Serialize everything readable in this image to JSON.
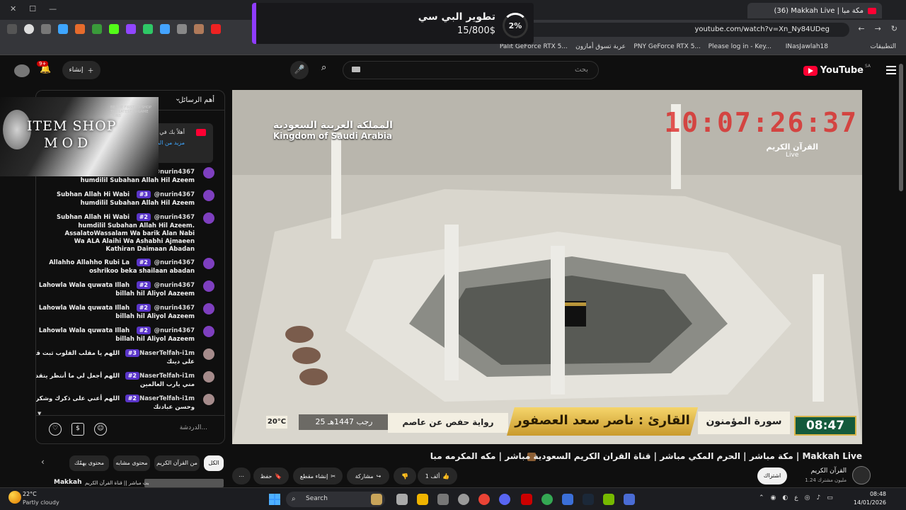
{
  "browser": {
    "tab_title": "(36) Makkah Live | مكة مبا",
    "url": "youtube.com/watch?v=Xn_Ny84UDeg",
    "bookmarks": [
      "التطبيقات",
      "INasJawlah18",
      "Please log in - Key...",
      "PNY GeForce RTX 5...",
      "عربة تسوق أمازون",
      "Palit GeForce RTX 5..."
    ]
  },
  "promo": {
    "title": "تطوير البي سي",
    "amount": "15/800$",
    "percent": "2%",
    "progress_fraction": 0.02
  },
  "header": {
    "logo_text": "YouTube",
    "region": "SA",
    "search_placeholder": "بحث",
    "create_label": "إنشاء",
    "notification_count": "9+"
  },
  "player": {
    "clock": "10:07:26:37",
    "channel_logo_title": "القرآن الكريم",
    "channel_logo_sub": "Live",
    "country_ar": "المملكة العربية السعودية",
    "country_en": "Kingdom of Saudi Arabia",
    "time": "08:47",
    "surah": "سورة المؤمنون",
    "reciter": "القارئ : ناصر سعد العصفور",
    "riwaya": "رواية حفص عن عاصم",
    "hijri_date": "25 رجب 1447هـ",
    "temperature": "20°C"
  },
  "overlay": {
    "line1": "ITEM SHOP",
    "line2": "MOD",
    "tiny_text": "BE THE FIRST TO SHOP THE LATEST IN-GAME SKINS"
  },
  "chat": {
    "header": "أهم الرسائل",
    "pinned_text": "أهلاً بك في الدردشة المباشرة! يُرجى احترام الآخرين",
    "pinned_more": "مزيد من المعلومات",
    "input_placeholder": "الدردشة...",
    "messages": [
      {
        "user": "@nurin4367",
        "badge": "",
        "first": "",
        "text": "humdilil Subahan Allah Hil Azeem"
      },
      {
        "user": "@nurin4367",
        "badge": "#3",
        "first": "Subhan Allah Hi Wabi",
        "text": "humdilil Subahan Allah Hil Azeem"
      },
      {
        "user": "@nurin4367",
        "badge": "#2",
        "first": "Subhan Allah Hi Wabi",
        "text": "humdilil Subahan Allah Hil Azeem. AssalatoWassalam Wa barik Alan Nabi Wa ALA Alaihi Wa Ashabhi Ajmaeen Kathiran Daimaan Abadan"
      },
      {
        "user": "@nurin4367",
        "badge": "#2",
        "first": "Allahho Allahho Rubi La",
        "text": "oshrikoo beka shailaan abadan"
      },
      {
        "user": "@nurin4367",
        "badge": "#2",
        "first": "Lahowla Wala quwata Illah",
        "text": "billah hil Aliyol Aazeem"
      },
      {
        "user": "@nurin4367",
        "badge": "#2",
        "first": "Lahowla Wala quwata Illah",
        "text": "billah hil Aliyol Aazeem"
      },
      {
        "user": "@nurin4367",
        "badge": "#2",
        "first": "Lahowla Wala quwata Illah",
        "text": "billah hil Aliyol Aazeem"
      },
      {
        "user": "@NaserTelfah-i1m",
        "badge": "#3",
        "first": "اللهم يا مقلب القلوب ثبت قلبي",
        "text": "على دينك"
      },
      {
        "user": "@NaserTelfah-i1m",
        "badge": "#2",
        "first": "اللهم أجعل لي ما أنتظر يتقدم",
        "text": "مني يارب العالمين"
      },
      {
        "user": "@NaserTelfah-i1m",
        "badge": "#2",
        "first": "اللهم أعني على ذكرك وشكرك",
        "text": "وحسن عبادتك"
      }
    ]
  },
  "video": {
    "title": "مكة مباشر | الحرم المكي مباشر | قناة القران الكريم السعودية مباشر | مكه المكرمه مبا | Makkah Live",
    "channel": "القرآن الكريم",
    "subscribers": "1.24 مليون مشترك",
    "subscribe_label": "اشتراك",
    "likes": "1 ألف",
    "share_label": "مشاركة",
    "clip_label": "إنشاء مقطع",
    "save_label": "حفظ"
  },
  "chips": [
    "الكل",
    "من القرآن الكريم",
    "محتوى مشابه",
    "محتوى يهمّك"
  ],
  "recommendation": {
    "label": "Makkah",
    "thumb_text": "بث مباشر || قناة القرآن الكريم"
  },
  "taskbar": {
    "temperature": "22°C",
    "weather": "Partly cloudy",
    "search": "Search",
    "time": "08:48",
    "date": "14/01/2026",
    "lang": "ع"
  }
}
